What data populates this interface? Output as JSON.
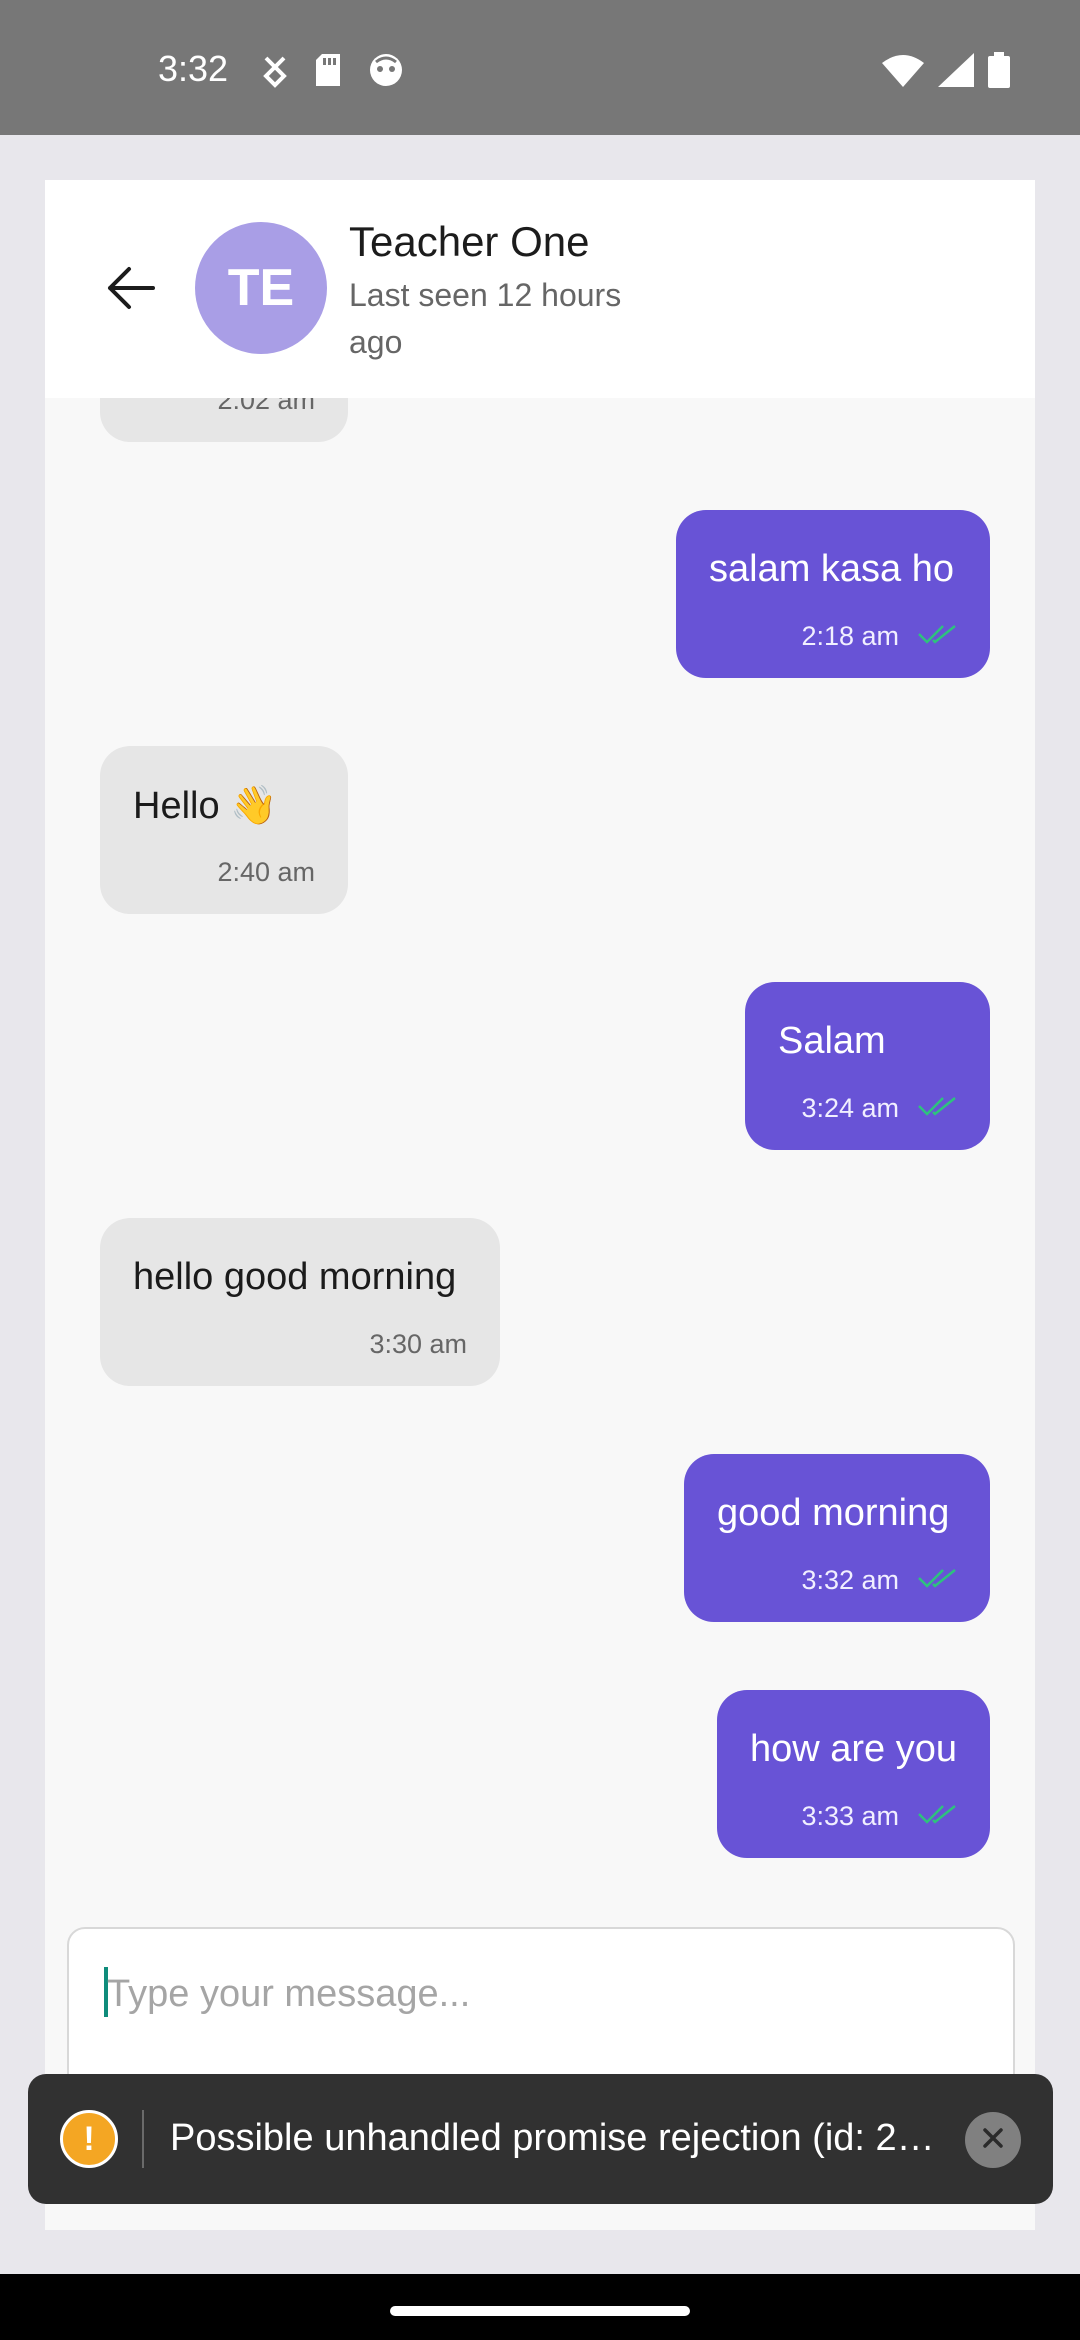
{
  "status_bar": {
    "time": "3:32",
    "left_icons": [
      "usb-debug-icon",
      "sd-card-icon",
      "notification-face-icon"
    ],
    "right_icons": [
      "wifi-icon",
      "signal-icon",
      "battery-icon"
    ]
  },
  "header": {
    "back_icon": "back-arrow-icon",
    "avatar_initials": "TE",
    "avatar_color": "#a99ee6",
    "name": "Teacher One",
    "status": "Last seen 12 hours ago"
  },
  "messages": [
    {
      "direction": "in",
      "text": "",
      "time": "2:02 am"
    },
    {
      "direction": "out",
      "text": "salam kasa ho",
      "time": "2:18 am",
      "read": true
    },
    {
      "direction": "in",
      "text": "Hello 👋",
      "time": "2:40 am"
    },
    {
      "direction": "out",
      "text": "Salam",
      "time": "3:24 am",
      "read": true
    },
    {
      "direction": "in",
      "text": "hello good morning",
      "time": "3:30 am"
    },
    {
      "direction": "out",
      "text": "good morning",
      "time": "3:32 am",
      "read": true
    },
    {
      "direction": "out",
      "text": "how are you",
      "time": "3:33 am",
      "read": true
    }
  ],
  "composer": {
    "placeholder": "Type your message...",
    "value": ""
  },
  "toast": {
    "icon": "warning-icon",
    "icon_glyph": "!",
    "message": "Possible unhandled promise rejection (id: 2…",
    "close_icon": "close-icon"
  },
  "colors": {
    "outgoing_bubble": "#6853d6",
    "incoming_bubble": "#e6e6e6",
    "read_check": "#2ec27e"
  }
}
